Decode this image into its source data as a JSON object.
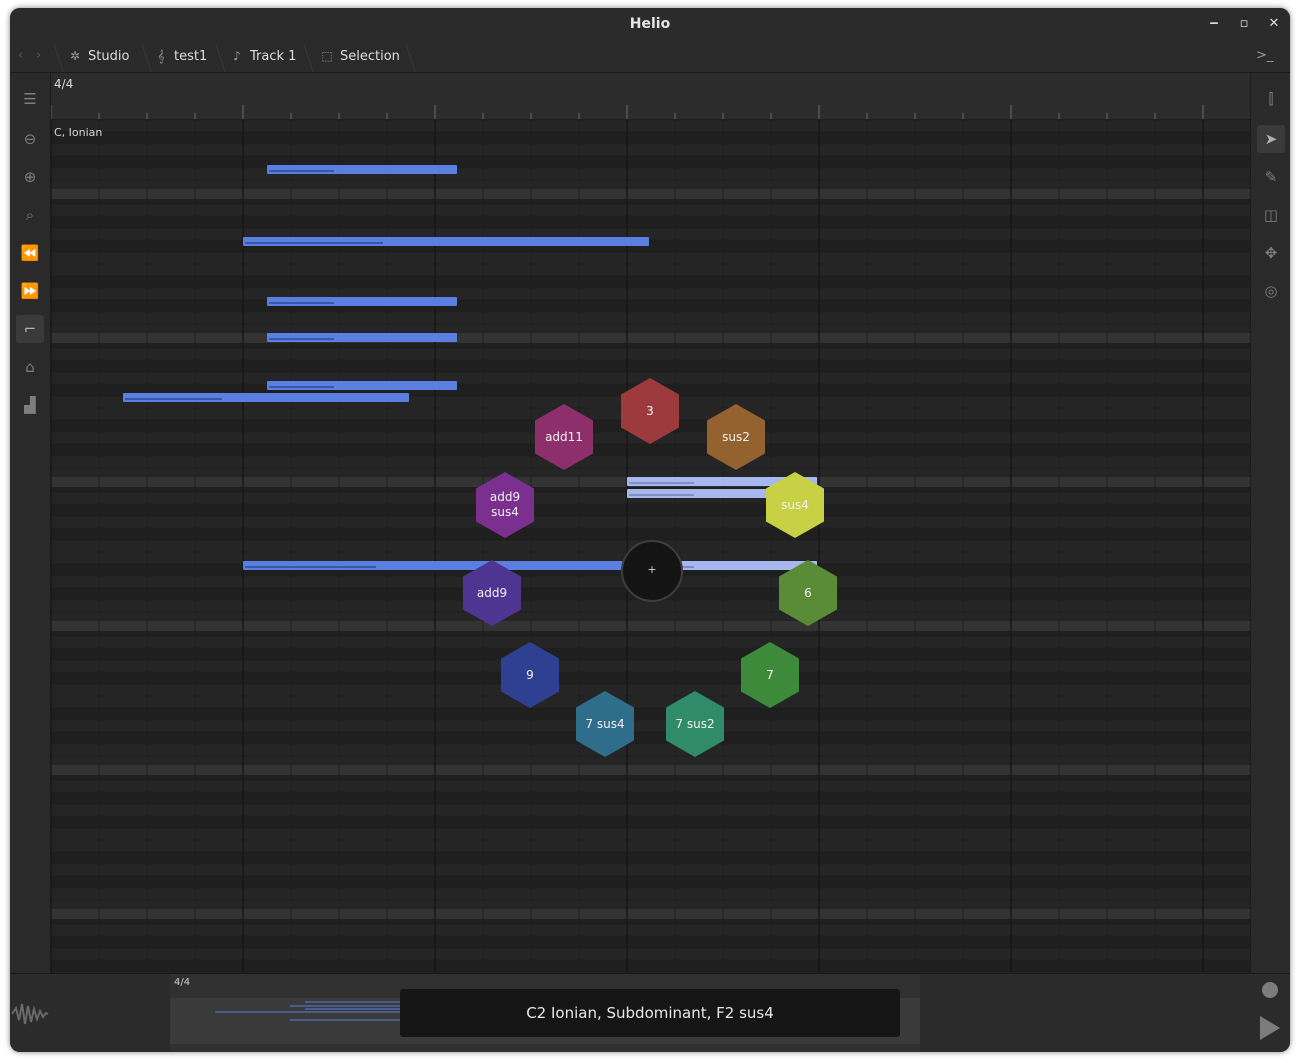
{
  "window": {
    "title": "Helio"
  },
  "breadcrumbs": [
    {
      "label": "Studio",
      "icon": "studio-icon"
    },
    {
      "label": "test1",
      "icon": "clef-icon"
    },
    {
      "label": "Track 1",
      "icon": "note-icon"
    },
    {
      "label": "Selection",
      "icon": "selection-icon"
    }
  ],
  "ruler": {
    "time_signature": "4/4"
  },
  "key_signature": "C, Ionian",
  "chord_tool": {
    "center_label": "+",
    "chords": [
      {
        "label": "3",
        "color": "#9c3a3d"
      },
      {
        "label": "sus2",
        "color": "#94622f"
      },
      {
        "label": "sus4",
        "color": "#c8d143"
      },
      {
        "label": "6",
        "color": "#5a8c38"
      },
      {
        "label": "7",
        "color": "#3d8a3a"
      },
      {
        "label": "7 sus2",
        "color": "#2f8b6a"
      },
      {
        "label": "7 sus4",
        "color": "#2e6e8a"
      },
      {
        "label": "9",
        "color": "#2f3f91"
      },
      {
        "label": "add9",
        "color": "#4f3592"
      },
      {
        "label": "add9 sus4",
        "color": "#7b2f8e"
      },
      {
        "label": "add11",
        "color": "#8d2f6b"
      }
    ]
  },
  "minimap": {
    "time_signature": "4/4"
  },
  "status_message": "C2 Ionian, Subdominant, F2 sus4",
  "colors": {
    "note": "#5b7fe0",
    "selected_note": "#a6b8ee"
  }
}
